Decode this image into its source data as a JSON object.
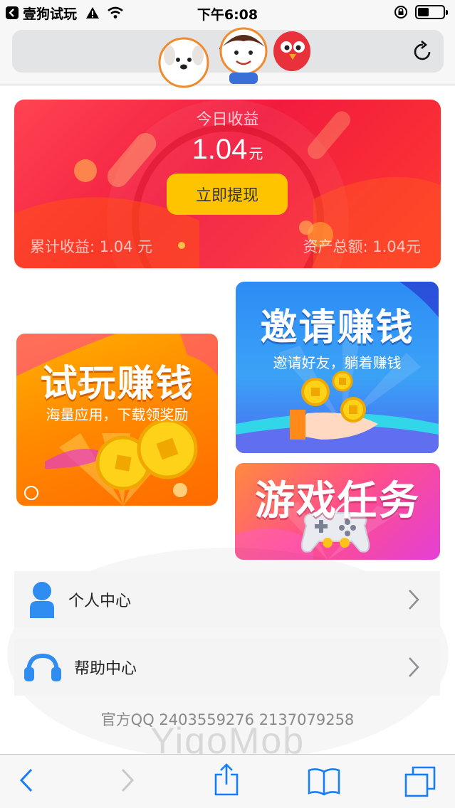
{
  "status_bar": {
    "back_app_label": "壹狗试玩",
    "time": "下午6:08",
    "battery_level": 0.45
  },
  "browser": {
    "url_text": "vig"
  },
  "earnings": {
    "title": "今日收益",
    "amount": "1.04",
    "unit": "元",
    "withdraw_label": "立即提现",
    "cumulative": "累计收益: 1.04 元",
    "total_assets": "资产总额: 1.04元"
  },
  "tiles": {
    "trial": {
      "title": "试玩赚钱",
      "subtitle": "海量应用，下载领奖励"
    },
    "invite": {
      "title": "邀请赚钱",
      "subtitle": "邀请好友，躺着赚钱"
    },
    "game": {
      "title": "游戏任务"
    }
  },
  "menu": {
    "items": [
      {
        "label": "个人中心",
        "icon": "user-icon"
      },
      {
        "label": "帮助中心",
        "icon": "headset-icon"
      }
    ]
  },
  "footer": {
    "contact": "官方QQ 2403559276 2137079258",
    "brand_watermark": "YiqoMob"
  },
  "toolbar": {
    "icons": [
      "back-icon",
      "forward-icon",
      "share-icon",
      "bookmarks-icon",
      "tabs-icon"
    ]
  },
  "colors": {
    "accent_blue": "#157efb",
    "card_red": "#f21b3f",
    "button_yellow": "#ffc400"
  }
}
